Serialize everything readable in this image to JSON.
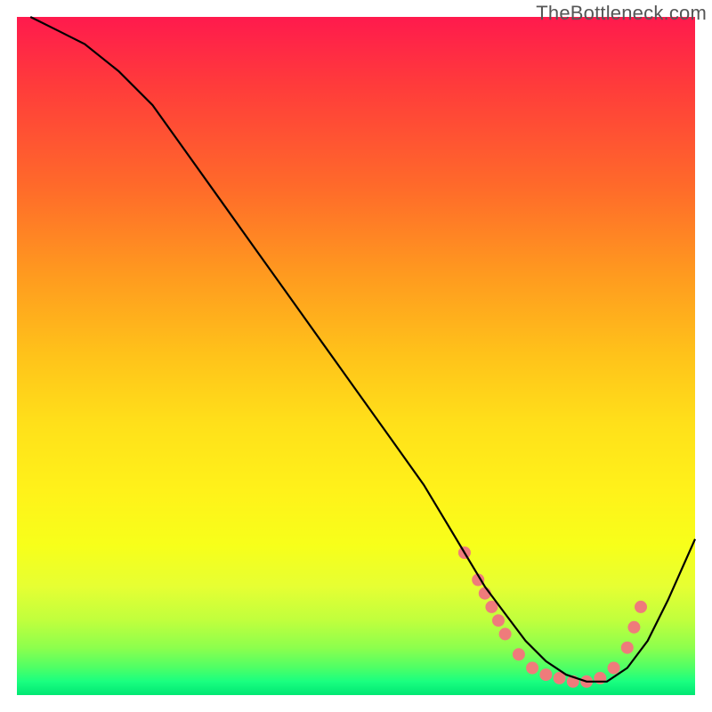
{
  "watermark": "TheBottleneck.com",
  "chart_data": {
    "type": "line",
    "title": "",
    "xlabel": "",
    "ylabel": "",
    "xlim": [
      0,
      100
    ],
    "ylim": [
      0,
      100
    ],
    "description": "Bottleneck curve: a single black line descending from top-left, reaching a minimum trough near x≈75–85, then rising again toward the right edge. A cluster of salmon-colored dots highlights the trough region. Background is a vertical rainbow gradient (red at top through orange/yellow to green at bottom).",
    "series": [
      {
        "name": "bottleneck-curve",
        "x": [
          2,
          6,
          10,
          15,
          20,
          25,
          30,
          35,
          40,
          45,
          50,
          55,
          60,
          63,
          66,
          69,
          72,
          75,
          78,
          81,
          84,
          87,
          90,
          93,
          96,
          100
        ],
        "y": [
          100,
          98,
          96,
          92,
          87,
          80,
          73,
          66,
          59,
          52,
          45,
          38,
          31,
          26,
          21,
          16,
          12,
          8,
          5,
          3,
          2,
          2,
          4,
          8,
          14,
          23
        ]
      }
    ],
    "highlight_points": {
      "name": "trough-dots",
      "color": "#ef7b7b",
      "points": [
        {
          "x": 66,
          "y": 21
        },
        {
          "x": 68,
          "y": 17
        },
        {
          "x": 69,
          "y": 15
        },
        {
          "x": 70,
          "y": 13
        },
        {
          "x": 71,
          "y": 11
        },
        {
          "x": 72,
          "y": 9
        },
        {
          "x": 74,
          "y": 6
        },
        {
          "x": 76,
          "y": 4
        },
        {
          "x": 78,
          "y": 3
        },
        {
          "x": 80,
          "y": 2.5
        },
        {
          "x": 82,
          "y": 2
        },
        {
          "x": 84,
          "y": 2
        },
        {
          "x": 86,
          "y": 2.5
        },
        {
          "x": 88,
          "y": 4
        },
        {
          "x": 90,
          "y": 7
        },
        {
          "x": 91,
          "y": 10
        },
        {
          "x": 92,
          "y": 13
        }
      ]
    }
  }
}
